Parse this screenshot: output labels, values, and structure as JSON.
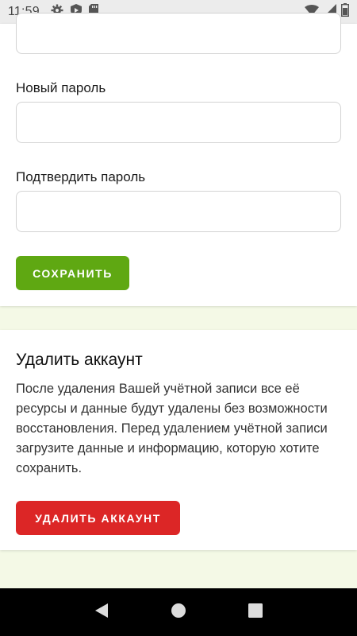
{
  "status_bar": {
    "time": "11:59",
    "icons": [
      "gear-icon",
      "shield-icon",
      "sd-card-icon"
    ],
    "right_icons": [
      "wifi-icon",
      "signal-icon",
      "battery-icon"
    ]
  },
  "password_form": {
    "new_password_label": "Новый пароль",
    "confirm_password_label": "Подтвердить пароль",
    "current_password_value": "",
    "new_password_value": "",
    "confirm_password_value": "",
    "save_button_label": "СОХРАНИТЬ"
  },
  "delete_account": {
    "title": "Удалить аккаунт",
    "description": "После удаления Вашей учётной записи все её ресурсы и данные будут удалены без возможности восстановления. Перед удалением учётной записи загрузите данные и информацию, которую хотите сохранить.",
    "button_label": "УДАЛИТЬ АККАУНТ"
  },
  "nav_bar": {
    "buttons": [
      "back-icon",
      "home-icon",
      "recents-icon"
    ]
  },
  "colors": {
    "save": "#5fa812",
    "delete": "#dc2626",
    "page_bg": "#f4f9e6"
  }
}
